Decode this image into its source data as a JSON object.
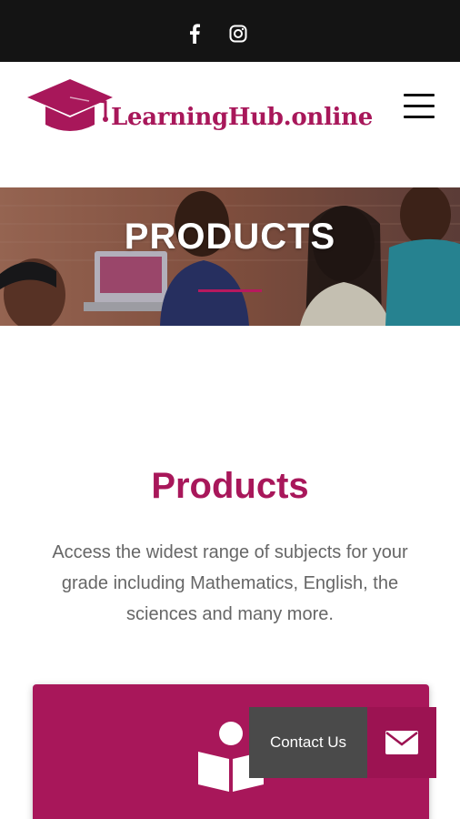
{
  "social": {
    "facebook_icon": "facebook-icon",
    "instagram_icon": "instagram-icon"
  },
  "header": {
    "logo_text": "LearningHub.online",
    "menu_icon": "hamburger-menu-icon"
  },
  "hero": {
    "title": "PRODUCTS"
  },
  "main": {
    "title": "Products",
    "description": "Access the widest range of subjects for your grade including Mathematics, English, the sciences and many more."
  },
  "card": {
    "icon": "reader-book-icon"
  },
  "contact": {
    "label": "Contact Us",
    "icon": "envelope-icon"
  },
  "colors": {
    "brand": "#a8175a",
    "topbar": "#141414",
    "contact_bg": "#4a4a4a",
    "contact_icon_bg": "#9c1352"
  }
}
